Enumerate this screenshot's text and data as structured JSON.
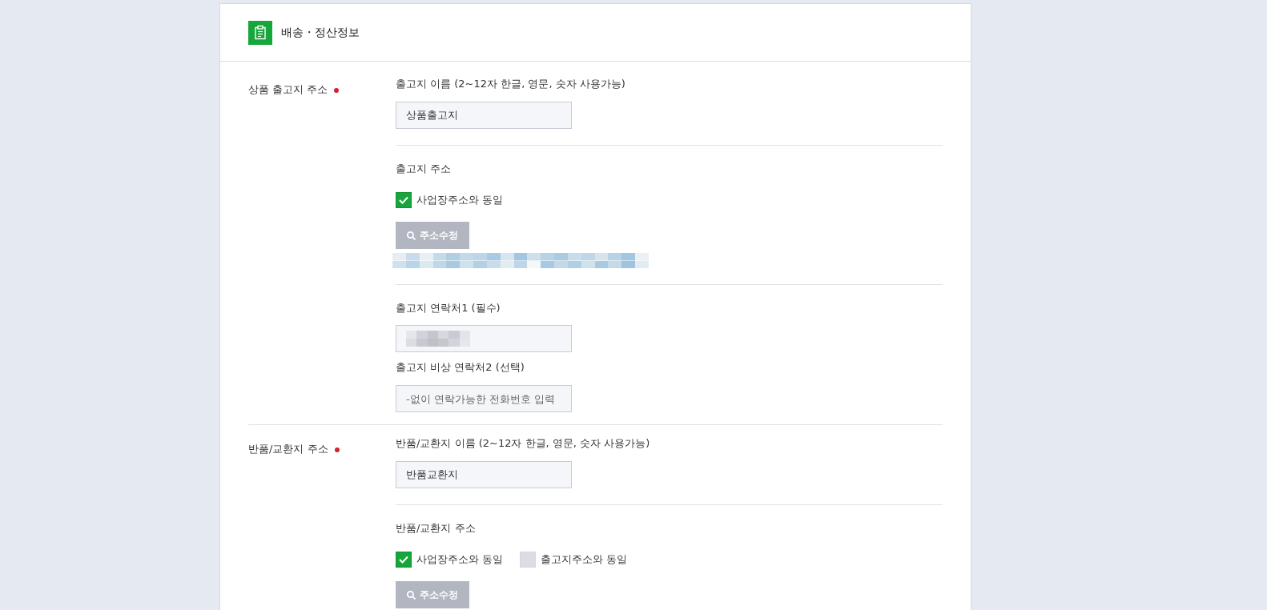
{
  "header": {
    "title": "배송・정산정보"
  },
  "sections": [
    {
      "label": "상품 출고지 주소",
      "required": true,
      "groups": [
        {
          "kind": "fields",
          "fields": [
            {
              "label": "출고지 이름 (2~12자 한글, 영문, 숫자 사용가능)",
              "value": "상품출고지"
            }
          ]
        },
        {
          "kind": "address",
          "label": "출고지 주소",
          "options": [
            {
              "label": "사업장주소와 동일",
              "checked": true
            }
          ],
          "button": "주소수정",
          "redacted": true
        },
        {
          "kind": "fields",
          "fields": [
            {
              "label": "출고지 연락처1 (필수)",
              "redacted": true
            },
            {
              "label": "출고지 비상 연락처2 (선택)",
              "placeholder": "-없이 연락가능한 전화번호 입력"
            }
          ]
        }
      ]
    },
    {
      "label": "반품/교환지 주소",
      "required": true,
      "groups": [
        {
          "kind": "fields",
          "fields": [
            {
              "label": "반품/교환지 이름 (2~12자 한글, 영문, 숫자 사용가능)",
              "value": "반품교환지"
            }
          ]
        },
        {
          "kind": "address",
          "label": "반품/교환지 주소",
          "options": [
            {
              "label": "사업장주소와 동일",
              "checked": true
            },
            {
              "label": "출고지주소와 동일",
              "checked": false
            }
          ],
          "button": "주소수정"
        }
      ]
    }
  ]
}
